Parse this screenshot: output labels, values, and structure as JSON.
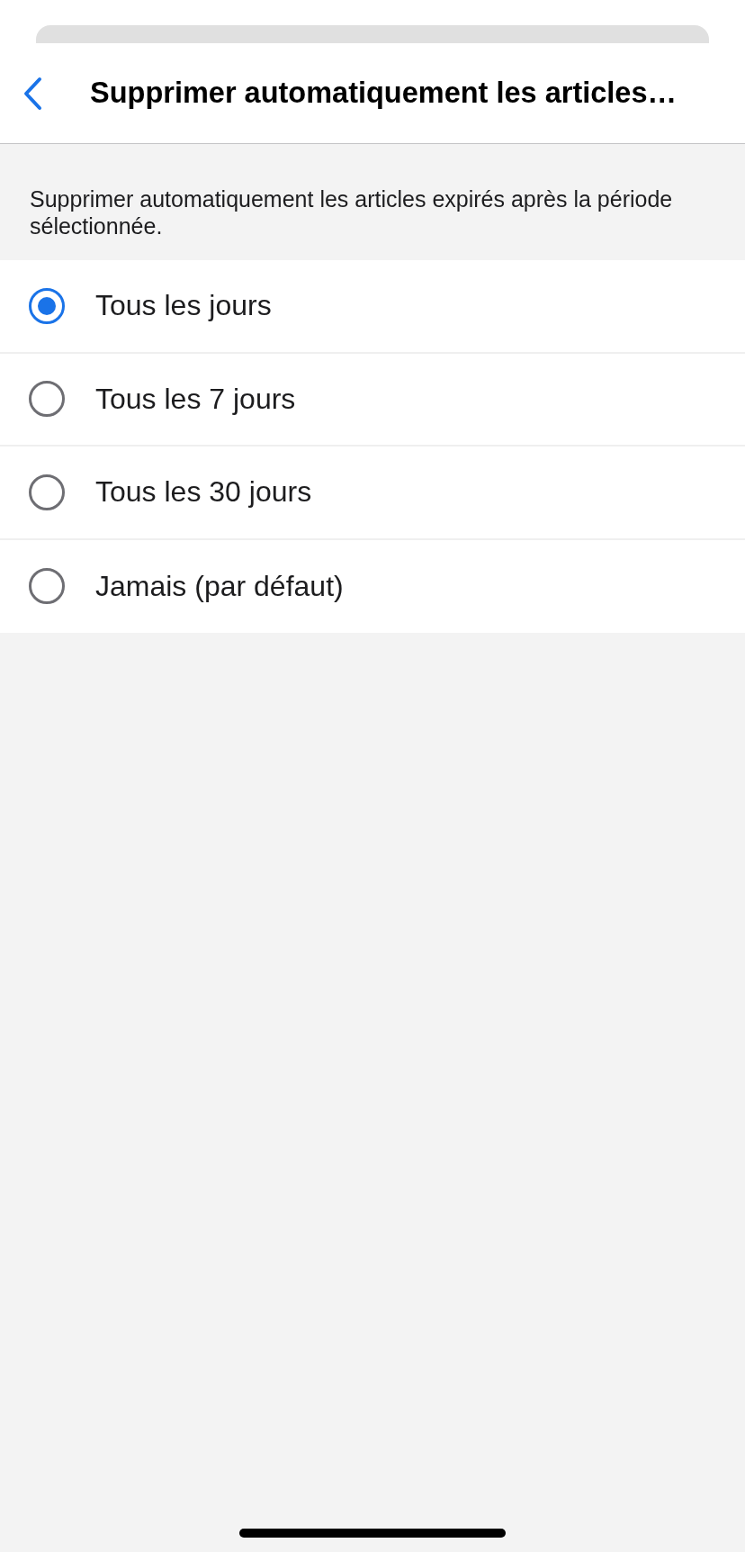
{
  "header": {
    "title": "Supprimer automatiquement les articles…"
  },
  "description": "Supprimer automatiquement les articles expirés après la période sélectionnée.",
  "options": [
    {
      "label": "Tous les jours",
      "selected": true
    },
    {
      "label": "Tous les 7 jours",
      "selected": false
    },
    {
      "label": "Tous les 30 jours",
      "selected": false
    },
    {
      "label": "Jamais (par défaut)",
      "selected": false
    }
  ]
}
